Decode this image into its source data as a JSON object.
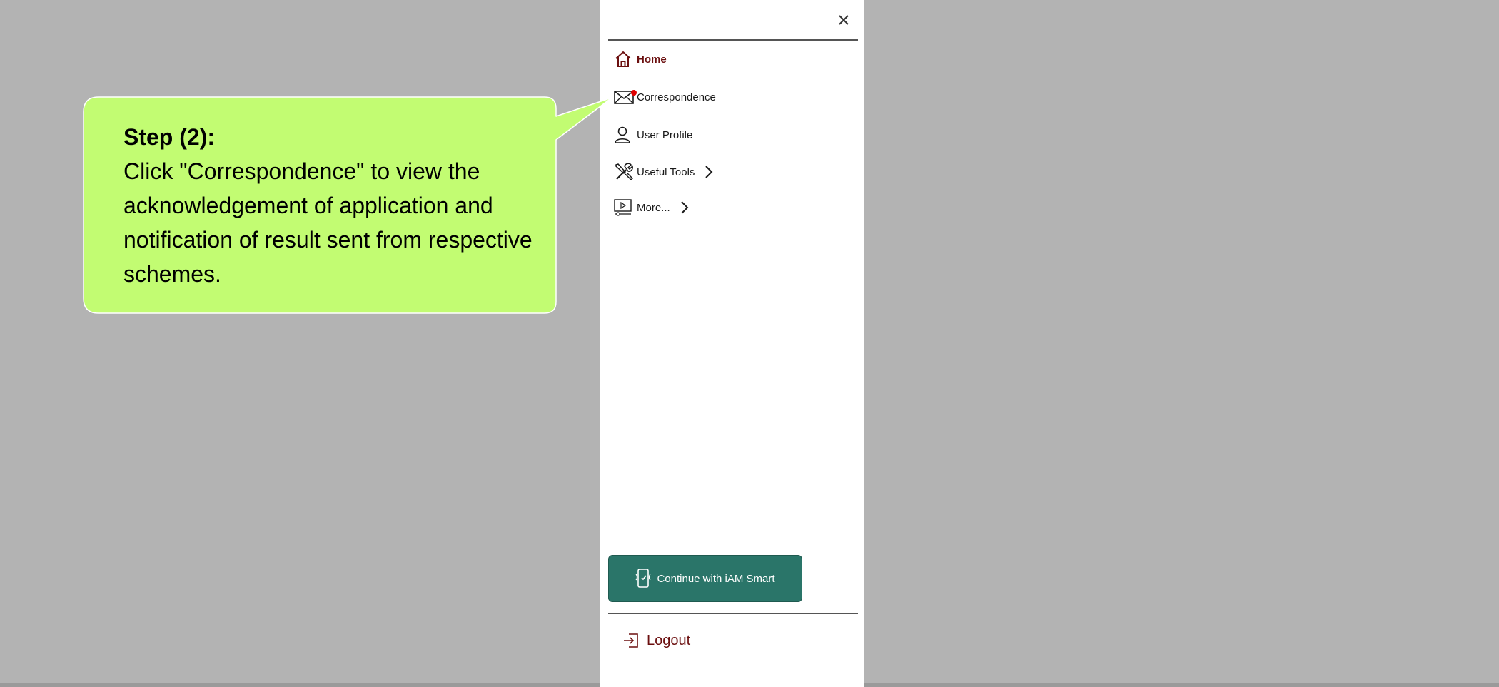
{
  "drawer": {
    "nav": [
      {
        "label": "Home",
        "icon": "home-icon",
        "active": true
      },
      {
        "label": "Correspondence",
        "icon": "envelope-icon",
        "notification": true
      },
      {
        "label": "User Profile",
        "icon": "user-icon"
      },
      {
        "label": "Useful Tools",
        "icon": "tools-icon",
        "has_submenu": true
      },
      {
        "label": "More...",
        "icon": "video-monitor-icon",
        "has_submenu": true
      }
    ],
    "iam_button_label": "Continue with iAM Smart",
    "logout_label": "Logout"
  },
  "callout": {
    "title": "Step (2):",
    "body": "Click \"Correspondence\" to view the acknowledgement of application and notification of result sent from respective schemes."
  },
  "colors": {
    "backdrop": "#b3b3b3",
    "active_text": "#6b0f0f",
    "iam_button": "#2a7569",
    "callout_fill": "#c2fc72",
    "notification_dot": "#e00000"
  }
}
